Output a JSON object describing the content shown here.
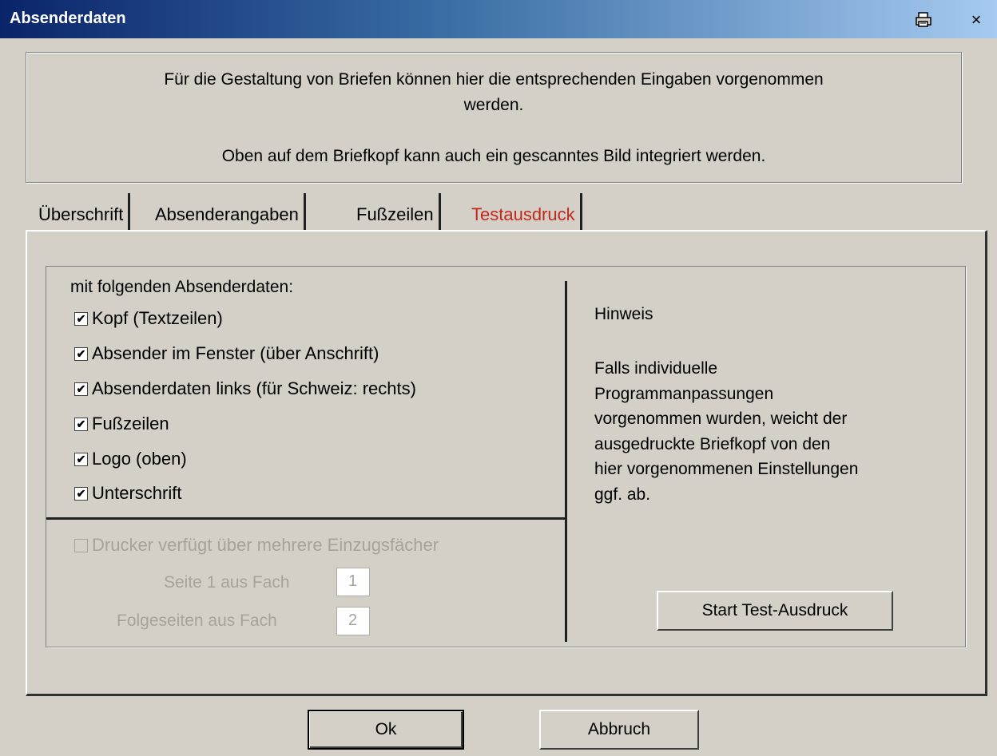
{
  "window": {
    "title": "Absenderdaten",
    "print_icon": "printer-icon",
    "close_glyph": "×"
  },
  "info": {
    "line1": "Für die Gestaltung von Briefen können hier die entsprechenden Eingaben vorgenommen",
    "line2": "werden.",
    "line3": "Oben auf dem Briefkopf kann auch ein gescanntes Bild integriert werden."
  },
  "tabs": [
    {
      "label": "Überschrift",
      "active": false
    },
    {
      "label": "Absenderangaben",
      "active": false
    },
    {
      "label": "Fußzeilen",
      "active": false
    },
    {
      "label": "Testausdruck",
      "active": true
    }
  ],
  "options": {
    "heading": "mit folgenden Absenderdaten:",
    "items": [
      {
        "label": "Kopf (Textzeilen)",
        "checked": true
      },
      {
        "label": "Absender im Fenster (über Anschrift)",
        "checked": true
      },
      {
        "label": "Absenderdaten links (für Schweiz: rechts)",
        "checked": true
      },
      {
        "label": "Fußzeilen",
        "checked": true
      },
      {
        "label": "Logo (oben)",
        "checked": true
      },
      {
        "label": "Unterschrift",
        "checked": true
      }
    ]
  },
  "printer": {
    "multi_tray_label": "Drucker verfügt über mehrere Einzugsfächer",
    "multi_tray_checked": false,
    "page1_label": "Seite 1 aus Fach",
    "page1_value": "1",
    "following_label": "Folgeseiten aus Fach",
    "following_value": "2"
  },
  "note": {
    "title": "Hinweis",
    "lines": [
      "Falls individuelle",
      "Programmanpassungen",
      "vorgenommen wurden, weicht der",
      "ausgedruckte Briefkopf von den",
      "hier vorgenommenen Einstellungen",
      "ggf. ab."
    ]
  },
  "buttons": {
    "test_print": "Start Test-Ausdruck",
    "ok": "Ok",
    "cancel": "Abbruch"
  },
  "colors": {
    "active_tab_text": "#c0281e",
    "titlebar_start": "#0a246a",
    "dialog_bg": "#d4d0c8"
  }
}
